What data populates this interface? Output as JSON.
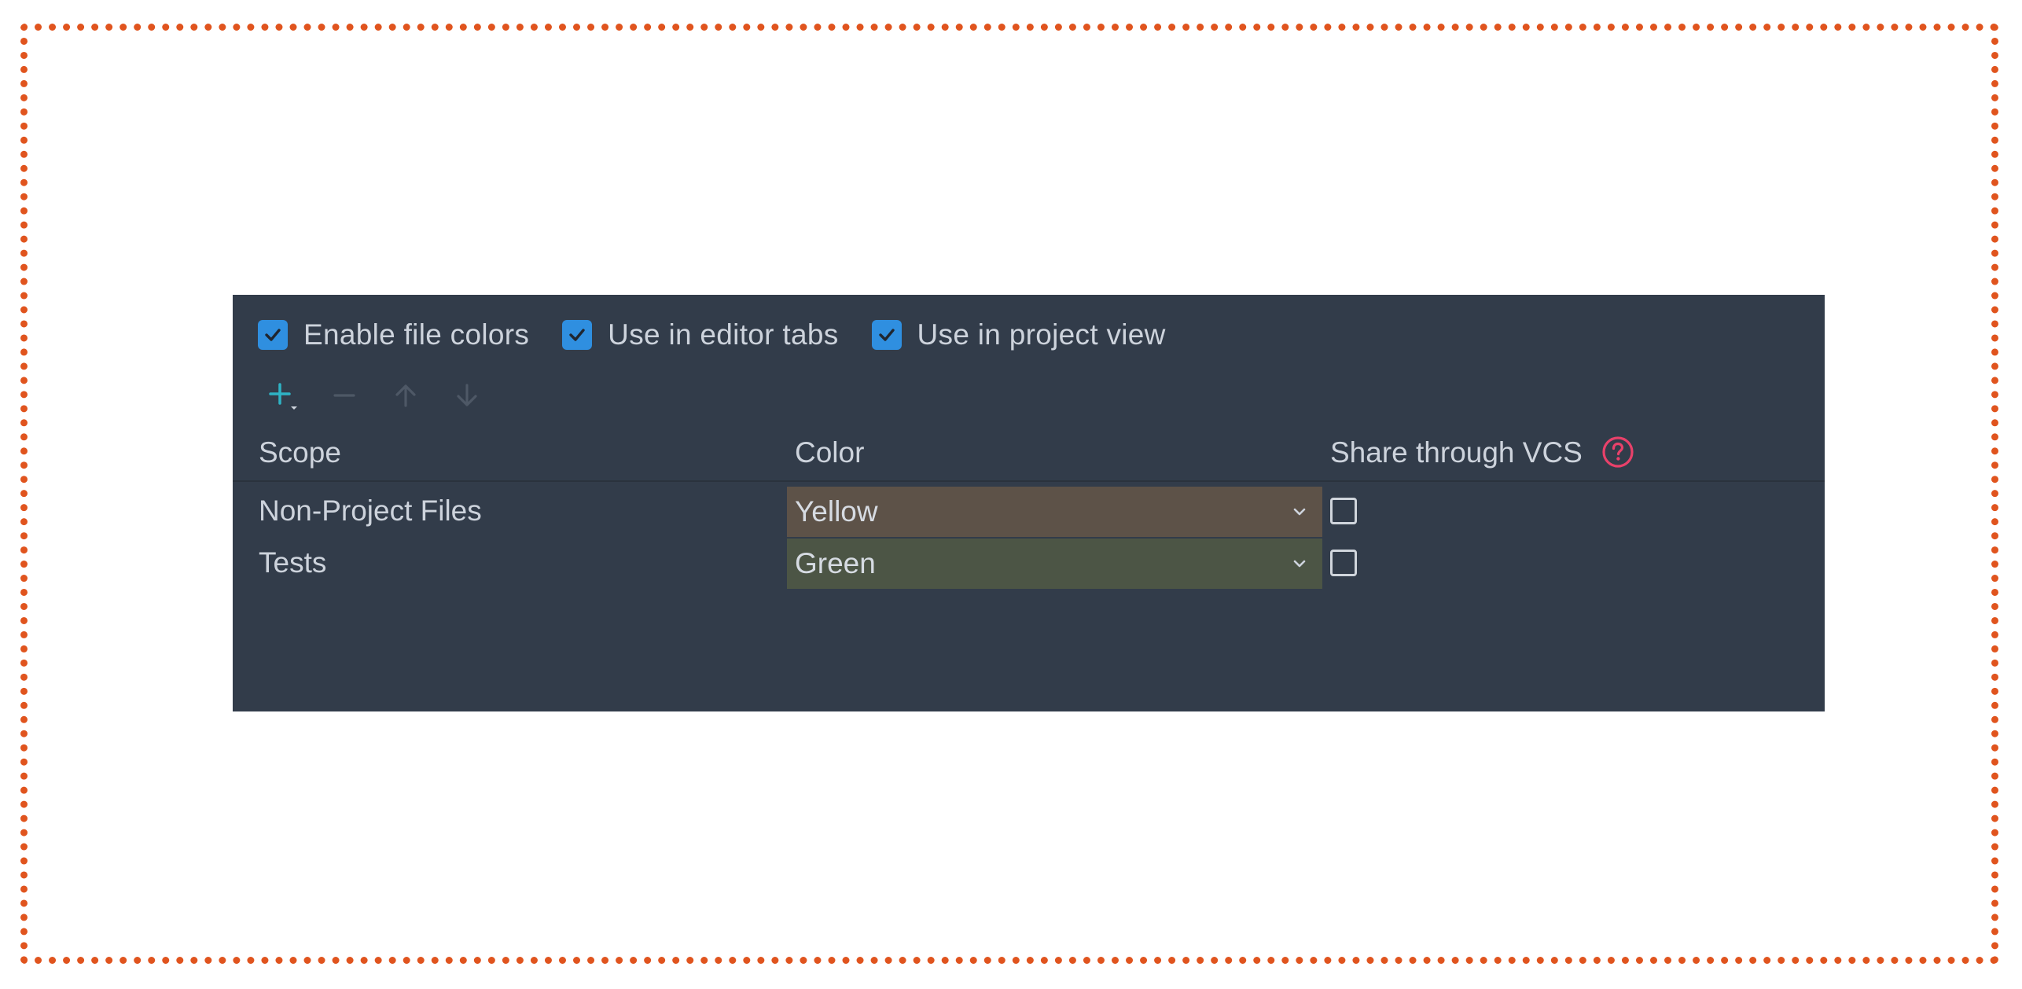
{
  "options": {
    "enable_file_colors": {
      "label": "Enable file colors",
      "checked": true
    },
    "use_in_editor_tabs": {
      "label": "Use in editor tabs",
      "checked": true
    },
    "use_in_project_view": {
      "label": "Use in project view",
      "checked": true
    }
  },
  "toolbar": {
    "add_icon": "plus-icon",
    "remove_icon": "minus-icon",
    "move_up_icon": "arrow-up-icon",
    "move_down_icon": "arrow-down-icon"
  },
  "table": {
    "columns": {
      "scope": "Scope",
      "color": "Color",
      "share": "Share through VCS"
    },
    "rows": [
      {
        "scope": "Non-Project Files",
        "color": "Yellow",
        "color_bg": "#5d5248",
        "shared": false
      },
      {
        "scope": "Tests",
        "color": "Green",
        "color_bg": "#4c5545",
        "shared": false
      }
    ]
  },
  "colors": {
    "panel_bg": "#323c4a",
    "checkbox_accent": "#2f8fe0",
    "add_icon_accent": "#2eb3c5",
    "help_icon": "#e8416a",
    "frame_border": "#e0541e"
  }
}
